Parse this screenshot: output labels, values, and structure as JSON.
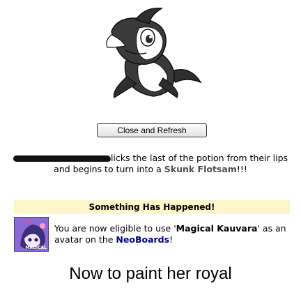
{
  "buttons": {
    "close_refresh": "Close and Refresh"
  },
  "transformation": {
    "message_lead": "licks the last of the potion from their lips",
    "message_mid": "and begins to turn into a ",
    "pet_name": "Skunk Flotsam",
    "suffix": "!!!"
  },
  "event": {
    "heading": "Something Has Happened!",
    "text_before": "You are now eligible to use '",
    "avatar_name": "Magical Kauvara",
    "text_middle": "' as an avatar on the ",
    "board_name": "NeoBoards",
    "text_after": "!",
    "avatar_caption": "MAGICAL"
  },
  "caption": "Now to paint her royal",
  "colors": {
    "banner_bg": "#fff7cc",
    "link": "#000080",
    "pet_link": "#4f4f4f"
  },
  "icons": {
    "pet": "skunk-flotsam-pet-image",
    "avatar": "magical-kauvara-avatar"
  }
}
